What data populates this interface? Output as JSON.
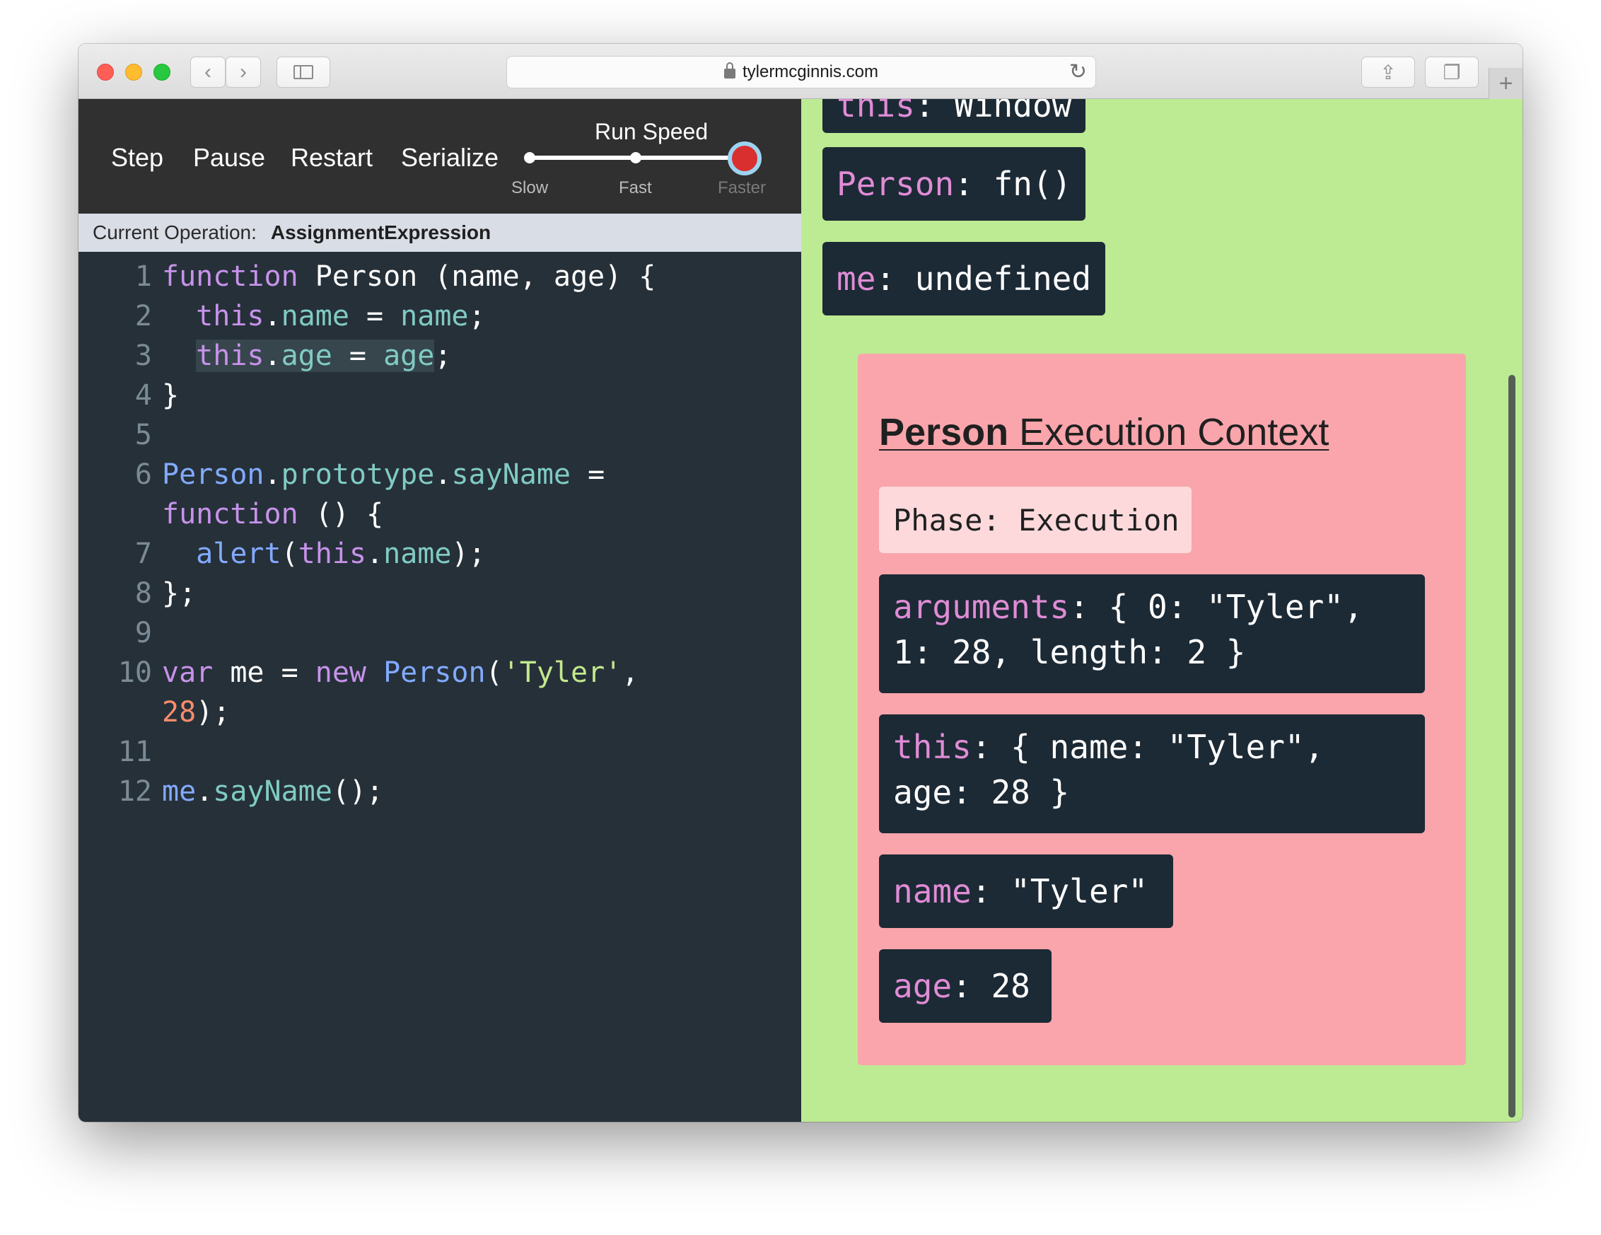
{
  "browser": {
    "url": "tylermcginnis.com"
  },
  "controls": {
    "step": "Step",
    "pause": "Pause",
    "restart": "Restart",
    "serialize": "Serialize",
    "run_speed": {
      "title": "Run Speed",
      "options": [
        "Slow",
        "Fast",
        "Faster"
      ],
      "selected": "Faster"
    }
  },
  "operation": {
    "label": "Current Operation:",
    "value": "AssignmentExpression"
  },
  "code": {
    "highlighted_line": 3,
    "line_numbers": [
      "1",
      "2",
      "3",
      "4",
      "5",
      "6",
      "7",
      "8",
      "9",
      "10",
      "11",
      "12"
    ]
  },
  "globals": {
    "this": {
      "key": "this",
      "value": "Window"
    },
    "person": {
      "key": "Person",
      "value": "fn()"
    },
    "me": {
      "key": "me",
      "value": "undefined"
    }
  },
  "context": {
    "name": "Person",
    "title_suffix": "Execution Context",
    "phase": "Phase: Execution",
    "arguments": {
      "key": "arguments",
      "line1": "{ 0: \"Tyler\",",
      "line2": "1: 28, length: 2 }"
    },
    "this": {
      "key": "this",
      "line1": "{ name: \"Tyler\",",
      "line2": "age: 28 }"
    },
    "name_var": {
      "key": "name",
      "value": "\"Tyler\""
    },
    "age_var": {
      "key": "age",
      "value": "28"
    }
  },
  "colors": {
    "editor_bg": "#263039",
    "controls_bg": "#303030",
    "global_bg": "#bdeb93",
    "context_bg": "#f9a5ab",
    "chip_bg": "#1c2a35",
    "key_pink": "#e08cd6",
    "keyword": "#c792ea",
    "function": "#82aaff",
    "property": "#80cbc4",
    "string": "#c3e88d",
    "number": "#f78c6c",
    "slider_thumb": "#d92f2f"
  },
  "icons": [
    "back-icon",
    "forward-icon",
    "sidebar-icon",
    "lock-icon",
    "reload-icon",
    "share-icon",
    "tabs-icon",
    "new-tab-icon"
  ]
}
